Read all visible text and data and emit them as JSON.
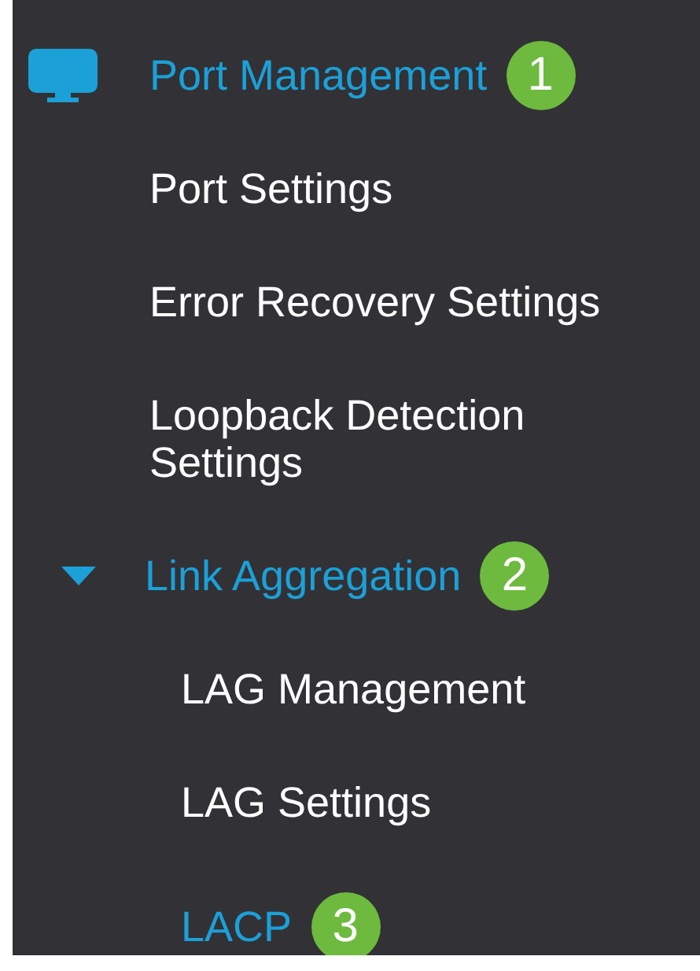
{
  "menu": {
    "label": "Port Management",
    "expanded": true,
    "badge": "1",
    "children": [
      {
        "kind": "link",
        "label": "Port Settings",
        "selected": false
      },
      {
        "kind": "link",
        "label": "Error Recovery Settings",
        "selected": false
      },
      {
        "kind": "link",
        "label": "Loopback Detection Settings",
        "selected": false
      },
      {
        "kind": "group",
        "label": "Link Aggregation",
        "expanded": true,
        "badge": "2",
        "children": [
          {
            "kind": "link",
            "label": "LAG Management",
            "selected": false
          },
          {
            "kind": "link",
            "label": "LAG Settings",
            "selected": false
          },
          {
            "kind": "link",
            "label": "LACP",
            "selected": true,
            "badge": "3"
          }
        ]
      }
    ]
  }
}
